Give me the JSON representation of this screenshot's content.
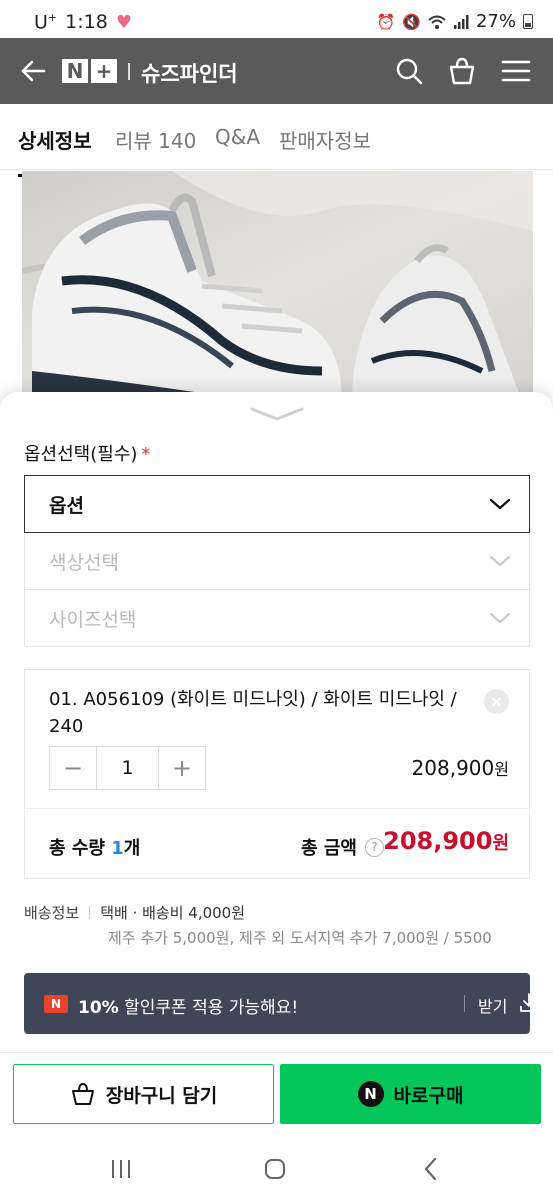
{
  "status_bar": {
    "carrier": "U",
    "carrier_sup": "+",
    "time": "1:18",
    "battery": "27%"
  },
  "header": {
    "logo_n": "N",
    "logo_plus": "+",
    "store_name": "슈즈파인더"
  },
  "tabs": [
    {
      "label": "상세정보",
      "active": true
    },
    {
      "label": "리뷰 140",
      "active": false
    },
    {
      "label": "Q&A",
      "active": false
    },
    {
      "label": "판매자정보",
      "active": false
    }
  ],
  "options": {
    "label": "옵션선택(필수)",
    "required_mark": "*",
    "main_select": "옵션",
    "color_select": "색상선택",
    "size_select": "사이즈선택"
  },
  "selected_item": {
    "name": "01. A056109 (화이트 미드나잇) / 화이트 미드나잇 / 240",
    "remove_icon": "×",
    "quantity": "1",
    "minus": "−",
    "plus": "+",
    "price": "208,900",
    "price_unit": "원"
  },
  "totals": {
    "qty_label": "총 수량",
    "qty_value": "1",
    "qty_unit": "개",
    "amount_label": "총 금액",
    "help": "?",
    "amount_value": "208,900",
    "amount_unit": "원"
  },
  "shipping": {
    "label": "배송정보",
    "method": "택배 · 배송비 4,000원",
    "extra": "제주 추가 5,000원, 제주 외 도서지역 추가 7,000원 / 5500"
  },
  "coupon": {
    "badge": "N",
    "percent": "10%",
    "text": "할인쿠폰 적용 가능해요!",
    "download": "받기"
  },
  "actions": {
    "cart": "장바구니 담기",
    "buy_badge": "N",
    "buy": "바로구매"
  },
  "colors": {
    "header_bg": "#5a5a5a",
    "price_red": "#c8102e",
    "naver_green": "#03c75a",
    "coupon_bg": "#3f4657",
    "qty_blue": "#1f8ae6"
  }
}
